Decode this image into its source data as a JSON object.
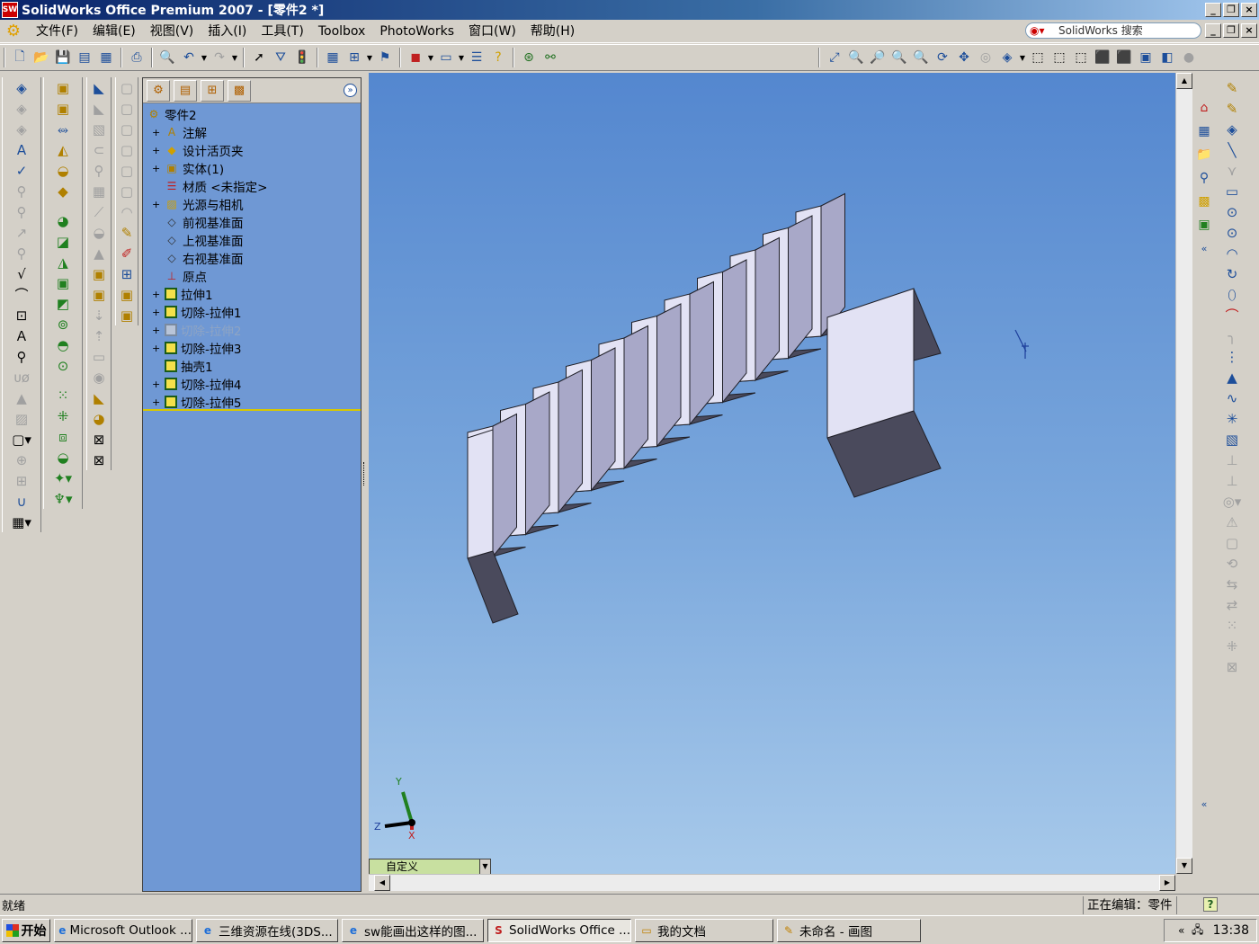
{
  "window": {
    "title": "SolidWorks Office Premium 2007 - [零件2 *]",
    "app_logo": "SW"
  },
  "menus": [
    "文件(F)",
    "编辑(E)",
    "视图(V)",
    "插入(I)",
    "工具(T)",
    "Toolbox",
    "PhotoWorks",
    "窗口(W)",
    "帮助(H)"
  ],
  "search": {
    "placeholder": "SolidWorks 搜索"
  },
  "feature_tree": {
    "root": "零件2",
    "items": [
      {
        "label": "注解",
        "icon": "annotation-icon",
        "expandable": true
      },
      {
        "label": "设计活页夹",
        "icon": "design-binder-icon",
        "expandable": true
      },
      {
        "label": "实体(1)",
        "icon": "solid-bodies-icon",
        "expandable": true
      },
      {
        "label": "材质 <未指定>",
        "icon": "material-icon",
        "expandable": false
      },
      {
        "label": "光源与相机",
        "icon": "lights-cameras-icon",
        "expandable": true
      },
      {
        "label": "前视基准面",
        "icon": "plane-icon",
        "expandable": false
      },
      {
        "label": "上视基准面",
        "icon": "plane-icon",
        "expandable": false
      },
      {
        "label": "右视基准面",
        "icon": "plane-icon",
        "expandable": false
      },
      {
        "label": "原点",
        "icon": "origin-icon",
        "expandable": false
      },
      {
        "label": "拉伸1",
        "icon": "extrude-feature-icon",
        "expandable": true
      },
      {
        "label": "切除-拉伸1",
        "icon": "cut-extrude-feature-icon",
        "expandable": true
      },
      {
        "label": "切除-拉伸2",
        "icon": "cut-extrude-feature-icon",
        "expandable": true,
        "suppressed": true
      },
      {
        "label": "切除-拉伸3",
        "icon": "cut-extrude-feature-icon",
        "expandable": true
      },
      {
        "label": "抽壳1",
        "icon": "shell-feature-icon",
        "expandable": false
      },
      {
        "label": "切除-拉伸4",
        "icon": "cut-extrude-feature-icon",
        "expandable": true
      },
      {
        "label": "切除-拉伸5",
        "icon": "cut-extrude-feature-icon",
        "expandable": true
      }
    ]
  },
  "viewport": {
    "view_orientation": "自定义",
    "triad": {
      "x": "X",
      "y": "Y",
      "z": "Z"
    }
  },
  "status": {
    "ready": "就绪",
    "editing": "正在编辑：零件",
    "help": "?"
  },
  "taskbar": {
    "start": "开始",
    "tasks": [
      {
        "label": "Microsoft Outlook ...",
        "icon": "ie-icon"
      },
      {
        "label": "三维资源在线(3DS...",
        "icon": "ie-icon"
      },
      {
        "label": "sw能画出这样的图...",
        "icon": "ie-icon"
      },
      {
        "label": "SolidWorks Office ...",
        "icon": "solidworks-icon",
        "active": true
      },
      {
        "label": "我的文档",
        "icon": "folder-icon"
      },
      {
        "label": "未命名 - 画图",
        "icon": "paint-icon"
      }
    ],
    "clock": "13:38",
    "tray_expand": "«"
  },
  "colors": {
    "viewport_top": "#5487cf",
    "viewport_bottom": "#a7c9ea",
    "face_light": "#e2e2f4",
    "face_mid": "#a8a8c8",
    "face_dark": "#4a4a5c",
    "tree_bg": "#6f98d4"
  }
}
